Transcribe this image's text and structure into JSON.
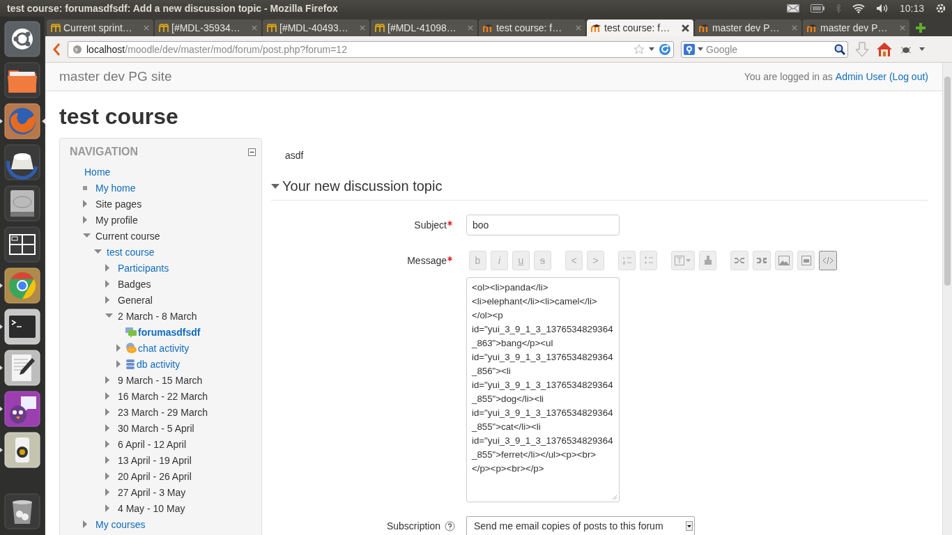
{
  "top_panel": {
    "title": "test course: forumasdfsdf: Add a new discussion topic - Mozilla Firefox",
    "clock": "10:13"
  },
  "launcher": [
    {
      "kind": "dash",
      "running": false,
      "focused": false
    },
    {
      "kind": "files",
      "running": false,
      "focused": false
    },
    {
      "kind": "firefox",
      "running": true,
      "focused": true
    },
    {
      "kind": "backup",
      "running": false,
      "focused": false
    },
    {
      "kind": "disk",
      "running": false,
      "focused": false
    },
    {
      "kind": "workspaces",
      "running": false,
      "focused": false
    },
    {
      "kind": "chrome",
      "running": true,
      "focused": false
    },
    {
      "kind": "terminal",
      "running": true,
      "focused": false
    },
    {
      "kind": "editor",
      "running": true,
      "focused": false
    },
    {
      "kind": "chat",
      "running": true,
      "focused": false
    },
    {
      "kind": "speaker",
      "running": true,
      "focused": false
    },
    {
      "kind": "trash",
      "running": false,
      "focused": false
    }
  ],
  "tabs": [
    {
      "label": "Current sprint…",
      "kind": "tracker",
      "selected": false
    },
    {
      "label": "[#MDL-35934…",
      "kind": "tracker",
      "selected": false
    },
    {
      "label": "[#MDL-40493…",
      "kind": "tracker",
      "selected": false
    },
    {
      "label": "[#MDL-41098…",
      "kind": "tracker",
      "selected": false
    },
    {
      "label": "test course: f…",
      "kind": "moodle",
      "selected": false
    },
    {
      "label": "test course: f…",
      "kind": "moodle",
      "selected": true
    },
    {
      "label": "master dev P…",
      "kind": "moodle",
      "selected": false
    },
    {
      "label": "master dev P…",
      "kind": "moodle",
      "selected": false
    }
  ],
  "address_bar": {
    "host": "localhost",
    "path": "/moodle/dev/master/mod/forum/post.php?forum=12"
  },
  "search_bar": {
    "placeholder": "Google"
  },
  "site": {
    "name": "master dev PG site",
    "login_prefix": "You are logged in as",
    "user": "Admin User",
    "logout": "(Log out)"
  },
  "course_title": "test course",
  "navigation": {
    "title": "NAVIGATION",
    "items": [
      {
        "label": "Home",
        "kind": "root",
        "link": true,
        "children": [
          {
            "label": "My home",
            "kind": "page",
            "link": true
          },
          {
            "label": "Site pages",
            "kind": "branch",
            "link": false,
            "expanded": false
          },
          {
            "label": "My profile",
            "kind": "branch",
            "link": false,
            "expanded": false
          },
          {
            "label": "Current course",
            "kind": "branch",
            "link": false,
            "expanded": true,
            "children": [
              {
                "label": "test course",
                "kind": "branch",
                "link": true,
                "expanded": true,
                "children": [
                  {
                    "label": "Participants",
                    "kind": "branch",
                    "link": true,
                    "expanded": false
                  },
                  {
                    "label": "Badges",
                    "kind": "branch",
                    "link": false,
                    "expanded": false
                  },
                  {
                    "label": "General",
                    "kind": "branch",
                    "link": false,
                    "expanded": false
                  },
                  {
                    "label": "2 March - 8 March",
                    "kind": "branch",
                    "link": false,
                    "expanded": true,
                    "children": [
                      {
                        "label": "forumasdfsdf",
                        "kind": "forum",
                        "link": true,
                        "current": true
                      },
                      {
                        "label": "chat activity",
                        "kind": "chat",
                        "link": true,
                        "expanded": false,
                        "current": false
                      },
                      {
                        "label": "db activity",
                        "kind": "database",
                        "link": true,
                        "expanded": false,
                        "current": false
                      }
                    ]
                  },
                  {
                    "label": "9 March - 15 March",
                    "kind": "branch",
                    "link": false,
                    "expanded": false
                  },
                  {
                    "label": "16 March - 22 March",
                    "kind": "branch",
                    "link": false,
                    "expanded": false
                  },
                  {
                    "label": "23 March - 29 March",
                    "kind": "branch",
                    "link": false,
                    "expanded": false
                  },
                  {
                    "label": "30 March - 5 April",
                    "kind": "branch",
                    "link": false,
                    "expanded": false
                  },
                  {
                    "label": "6 April - 12 April",
                    "kind": "branch",
                    "link": false,
                    "expanded": false
                  },
                  {
                    "label": "13 April - 19 April",
                    "kind": "branch",
                    "link": false,
                    "expanded": false
                  },
                  {
                    "label": "20 April - 26 April",
                    "kind": "branch",
                    "link": false,
                    "expanded": false
                  },
                  {
                    "label": "27 April - 3 May",
                    "kind": "branch",
                    "link": false,
                    "expanded": false
                  },
                  {
                    "label": "4 May - 10 May",
                    "kind": "branch",
                    "link": false,
                    "expanded": false
                  }
                ]
              }
            ]
          },
          {
            "label": "My courses",
            "kind": "branch",
            "link": true,
            "expanded": false
          }
        ]
      }
    ]
  },
  "intro": "asdf",
  "section": {
    "title": "Your new discussion topic",
    "expanded": true
  },
  "form": {
    "subject": {
      "label": "Subject",
      "required": true,
      "value": "boo"
    },
    "message": {
      "label": "Message",
      "required": true,
      "toolbar": [
        [
          {
            "kind": "bold",
            "label": "b",
            "selected": false
          },
          {
            "kind": "italic",
            "label": "i",
            "selected": false
          },
          {
            "kind": "underline",
            "label": "u",
            "selected": false
          },
          {
            "kind": "strike",
            "label": "s",
            "selected": false
          }
        ],
        [
          {
            "kind": "text",
            "label": "<",
            "selected": false
          },
          {
            "kind": "text",
            "label": ">",
            "selected": false
          }
        ],
        [
          {
            "kind": "ordered",
            "selected": false
          },
          {
            "kind": "unordered",
            "selected": false
          }
        ],
        [
          {
            "kind": "style",
            "selected": false
          },
          {
            "kind": "clean",
            "selected": false
          }
        ],
        [
          {
            "kind": "link",
            "selected": false
          },
          {
            "kind": "unlink",
            "selected": false
          },
          {
            "kind": "image",
            "selected": false
          },
          {
            "kind": "media",
            "selected": false
          },
          {
            "kind": "html",
            "selected": true
          }
        ]
      ],
      "value": "<ol><li>panda</li><li>elephant</li><li>camel</li></ol><p id=\"yui_3_9_1_3_1376534829364_863\">bang</p><ul id=\"yui_3_9_1_3_1376534829364_856\"><li id=\"yui_3_9_1_3_1376534829364_855\">dog</li><li id=\"yui_3_9_1_3_1376534829364_855\">cat</li><li id=\"yui_3_9_1_3_1376534829364_855\">ferret</li></ul><p><br></p><p><br></p>"
    },
    "subscription": {
      "label": "Subscription",
      "value": "Send me email copies of posts to this forum"
    }
  }
}
